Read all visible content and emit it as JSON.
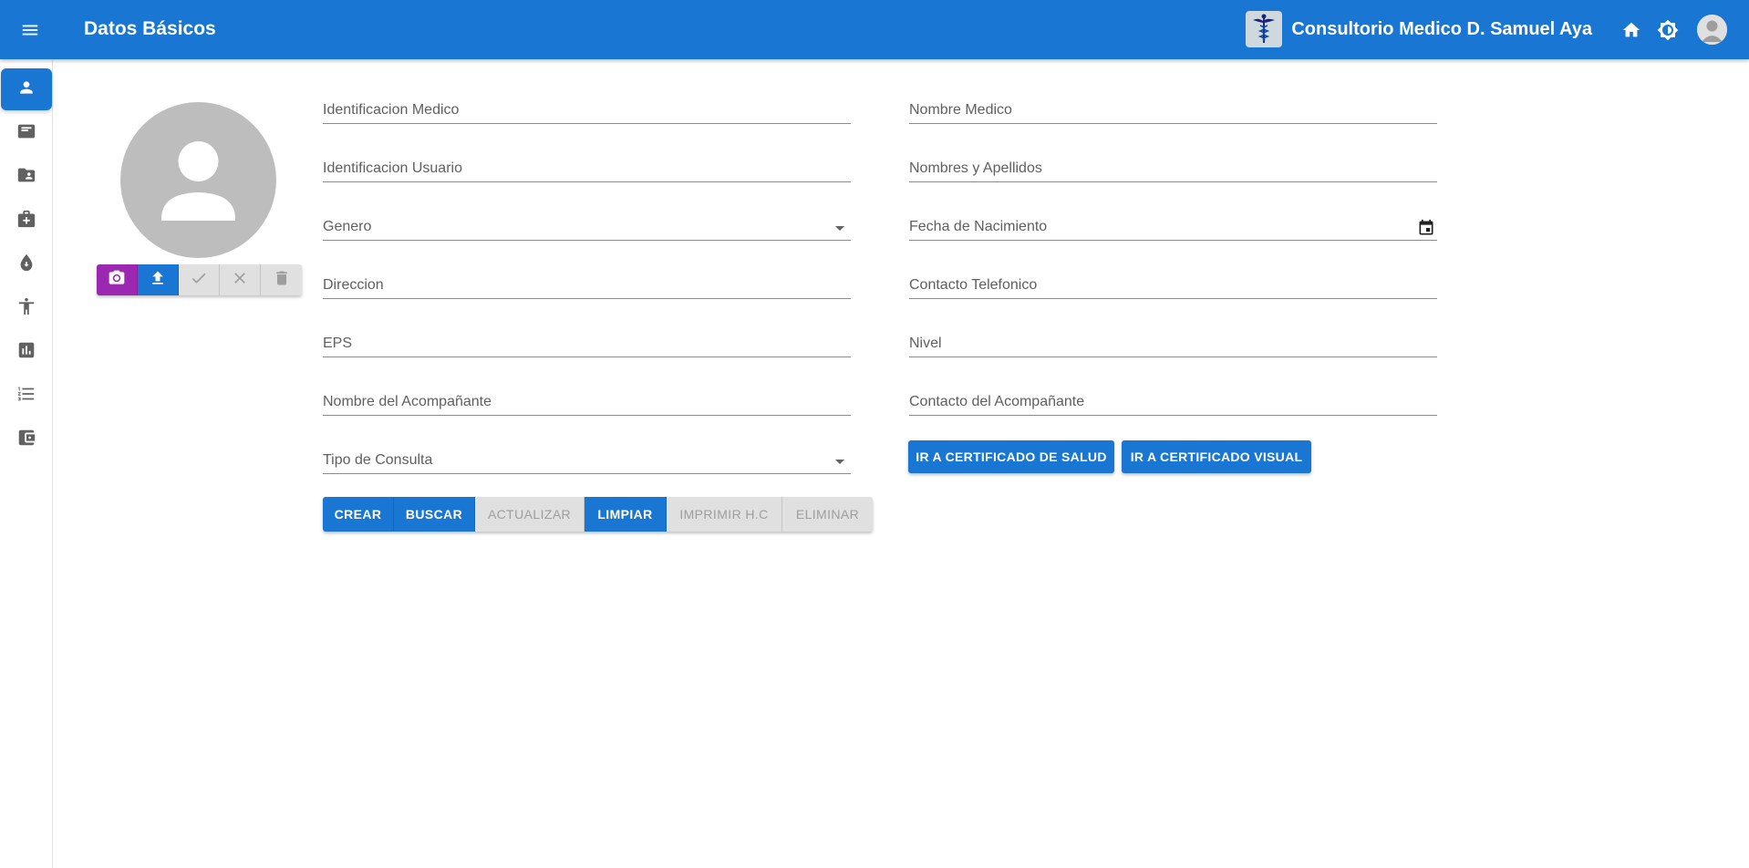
{
  "appbar": {
    "title": "Datos Básicos",
    "brand_name": "Consultorio Medico D. Samuel Aya",
    "menu_icon": "menu-icon",
    "home_icon": "home-icon",
    "theme_icon": "brightness-icon",
    "avatar_icon": "account-circle-icon"
  },
  "colors": {
    "primary": "#1976d2",
    "camera": "#9c27b0",
    "disabled": "#e0e0e0"
  },
  "sidebar": {
    "items": [
      {
        "icon": "person-icon",
        "active": true
      },
      {
        "icon": "card-icon",
        "active": false
      },
      {
        "icon": "folder-shared-icon",
        "active": false
      },
      {
        "icon": "medical-bag-icon",
        "active": false
      },
      {
        "icon": "drop-icon",
        "active": false
      },
      {
        "icon": "accessibility-icon",
        "active": false
      },
      {
        "icon": "bar-chart-icon",
        "active": false
      },
      {
        "icon": "format-list-numbered-icon",
        "active": false
      },
      {
        "icon": "wallet-icon",
        "active": false
      }
    ]
  },
  "photo": {
    "actions": [
      {
        "icon": "camera-icon",
        "enabled": true
      },
      {
        "icon": "upload-icon",
        "enabled": true
      },
      {
        "icon": "check-icon",
        "enabled": false
      },
      {
        "icon": "close-icon",
        "enabled": false
      },
      {
        "icon": "delete-icon",
        "enabled": false
      }
    ]
  },
  "form": {
    "left": [
      {
        "label": "Identificacion Medico",
        "value": ""
      },
      {
        "label": "Identificacion Usuario",
        "value": ""
      },
      {
        "label": "Genero",
        "value": "",
        "type": "select"
      },
      {
        "label": "Direccion",
        "value": ""
      },
      {
        "label": "EPS",
        "value": ""
      },
      {
        "label": "Nombre del Acompañante",
        "value": ""
      },
      {
        "label": "Tipo de Consulta",
        "value": "",
        "type": "select"
      }
    ],
    "right": [
      {
        "label": "Nombre Medico",
        "value": ""
      },
      {
        "label": "Nombres y Apellidos",
        "value": ""
      },
      {
        "label": "Fecha de Nacimiento",
        "value": "",
        "type": "date"
      },
      {
        "label": "Contacto Telefonico",
        "value": ""
      },
      {
        "label": "Nivel",
        "value": ""
      },
      {
        "label": "Contacto del Acompañante",
        "value": ""
      }
    ]
  },
  "actions": {
    "crear": "CREAR",
    "buscar": "BUSCAR",
    "actualizar": "ACTUALIZAR",
    "limpiar": "LIMPIAR",
    "imprimir": "IMPRIMIR H.C",
    "eliminar": "ELIMINAR"
  },
  "certificates": {
    "salud": "IR A CERTIFICADO DE SALUD",
    "visual": "IR A CERTIFICADO VISUAL"
  }
}
